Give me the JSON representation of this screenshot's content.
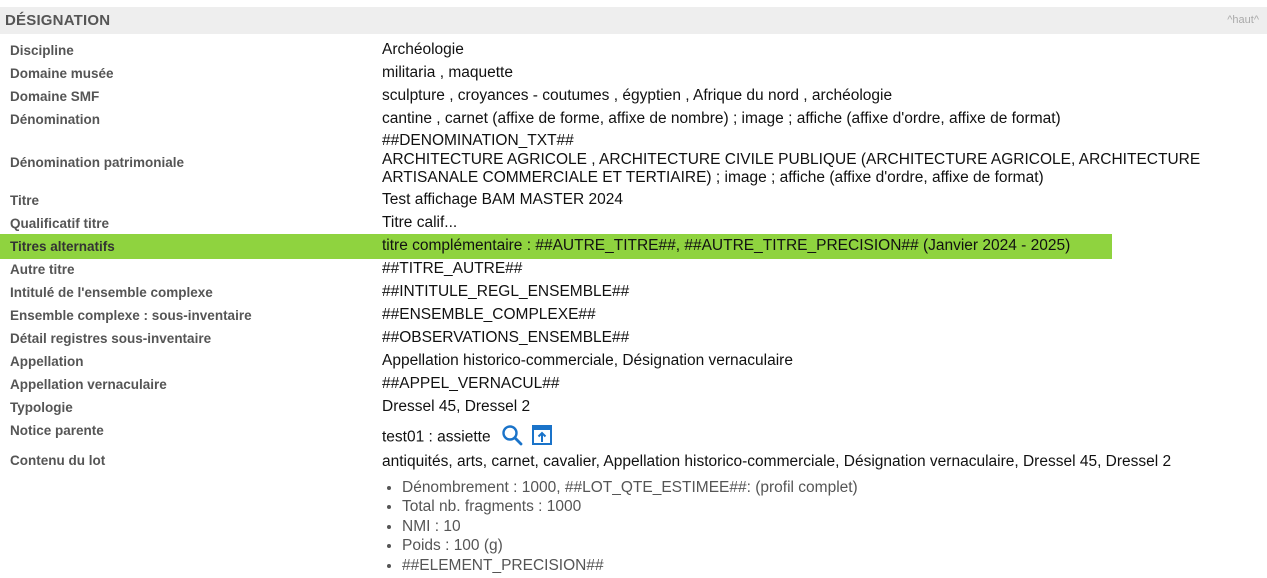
{
  "section": {
    "title": "DÉSIGNATION",
    "top_link": "^haut^"
  },
  "rows": [
    {
      "label": "Discipline",
      "value": "Archéologie"
    },
    {
      "label": "Domaine musée",
      "value": "militaria , maquette"
    },
    {
      "label": "Domaine SMF",
      "value": "sculpture , croyances - coutumes , égyptien , Afrique du nord , archéologie"
    },
    {
      "label": "Dénomination",
      "value": "cantine , carnet (affixe de forme, affixe de nombre) ; image ; affiche (affixe d'ordre, affixe de format)",
      "value2": "##DENOMINATION_TXT##"
    },
    {
      "label": "Dénomination patrimoniale",
      "value": "ARCHITECTURE AGRICOLE , ARCHITECTURE CIVILE PUBLIQUE (ARCHITECTURE AGRICOLE, ARCHITECTURE ARTISANALE COMMERCIALE ET TERTIAIRE) ; image ; affiche (affixe d'ordre, affixe de format)"
    },
    {
      "label": "Titre",
      "value": "Test affichage BAM MASTER 2024"
    },
    {
      "label": "Qualificatif titre",
      "value": "Titre calif..."
    },
    {
      "label": "Titres alternatifs",
      "value": "titre complémentaire : ##AUTRE_TITRE##, ##AUTRE_TITRE_PRECISION##  (Janvier 2024 - 2025)"
    },
    {
      "label": "Autre titre",
      "value": "##TITRE_AUTRE##"
    },
    {
      "label": "Intitulé de l'ensemble complexe",
      "value": "##INTITULE_REGL_ENSEMBLE##"
    },
    {
      "label": "Ensemble complexe : sous-inventaire",
      "value": "##ENSEMBLE_COMPLEXE##"
    },
    {
      "label": "Détail registres sous-inventaire",
      "value": "##OBSERVATIONS_ENSEMBLE##"
    },
    {
      "label": "Appellation",
      "value": "Appellation historico-commerciale, Désignation vernaculaire"
    },
    {
      "label": "Appellation vernaculaire",
      "value": "##APPEL_VERNACUL##"
    },
    {
      "label": "Typologie",
      "value": "Dressel 45, Dressel 2"
    },
    {
      "label": "Notice parente",
      "value": "test01 : assiette"
    },
    {
      "label": "Contenu du lot",
      "value": "antiquités, arts, carnet, cavalier, Appellation historico-commerciale, Désignation vernaculaire, Dressel 45, Dressel 2"
    }
  ],
  "lot_details": [
    "Dénombrement : 1000, ##LOT_QTE_ESTIMEE##: (profil complet)",
    "Total nb. fragments : 1000",
    "NMI : 10",
    "Poids : 100 (g)",
    "##ELEMENT_PRECISION##"
  ],
  "colors": {
    "highlight": "#8fd33f",
    "icon_blue": "#1a73c9",
    "header_bg": "#eeeeee"
  },
  "icons": {
    "search": "search-icon",
    "open": "open-external-icon"
  }
}
